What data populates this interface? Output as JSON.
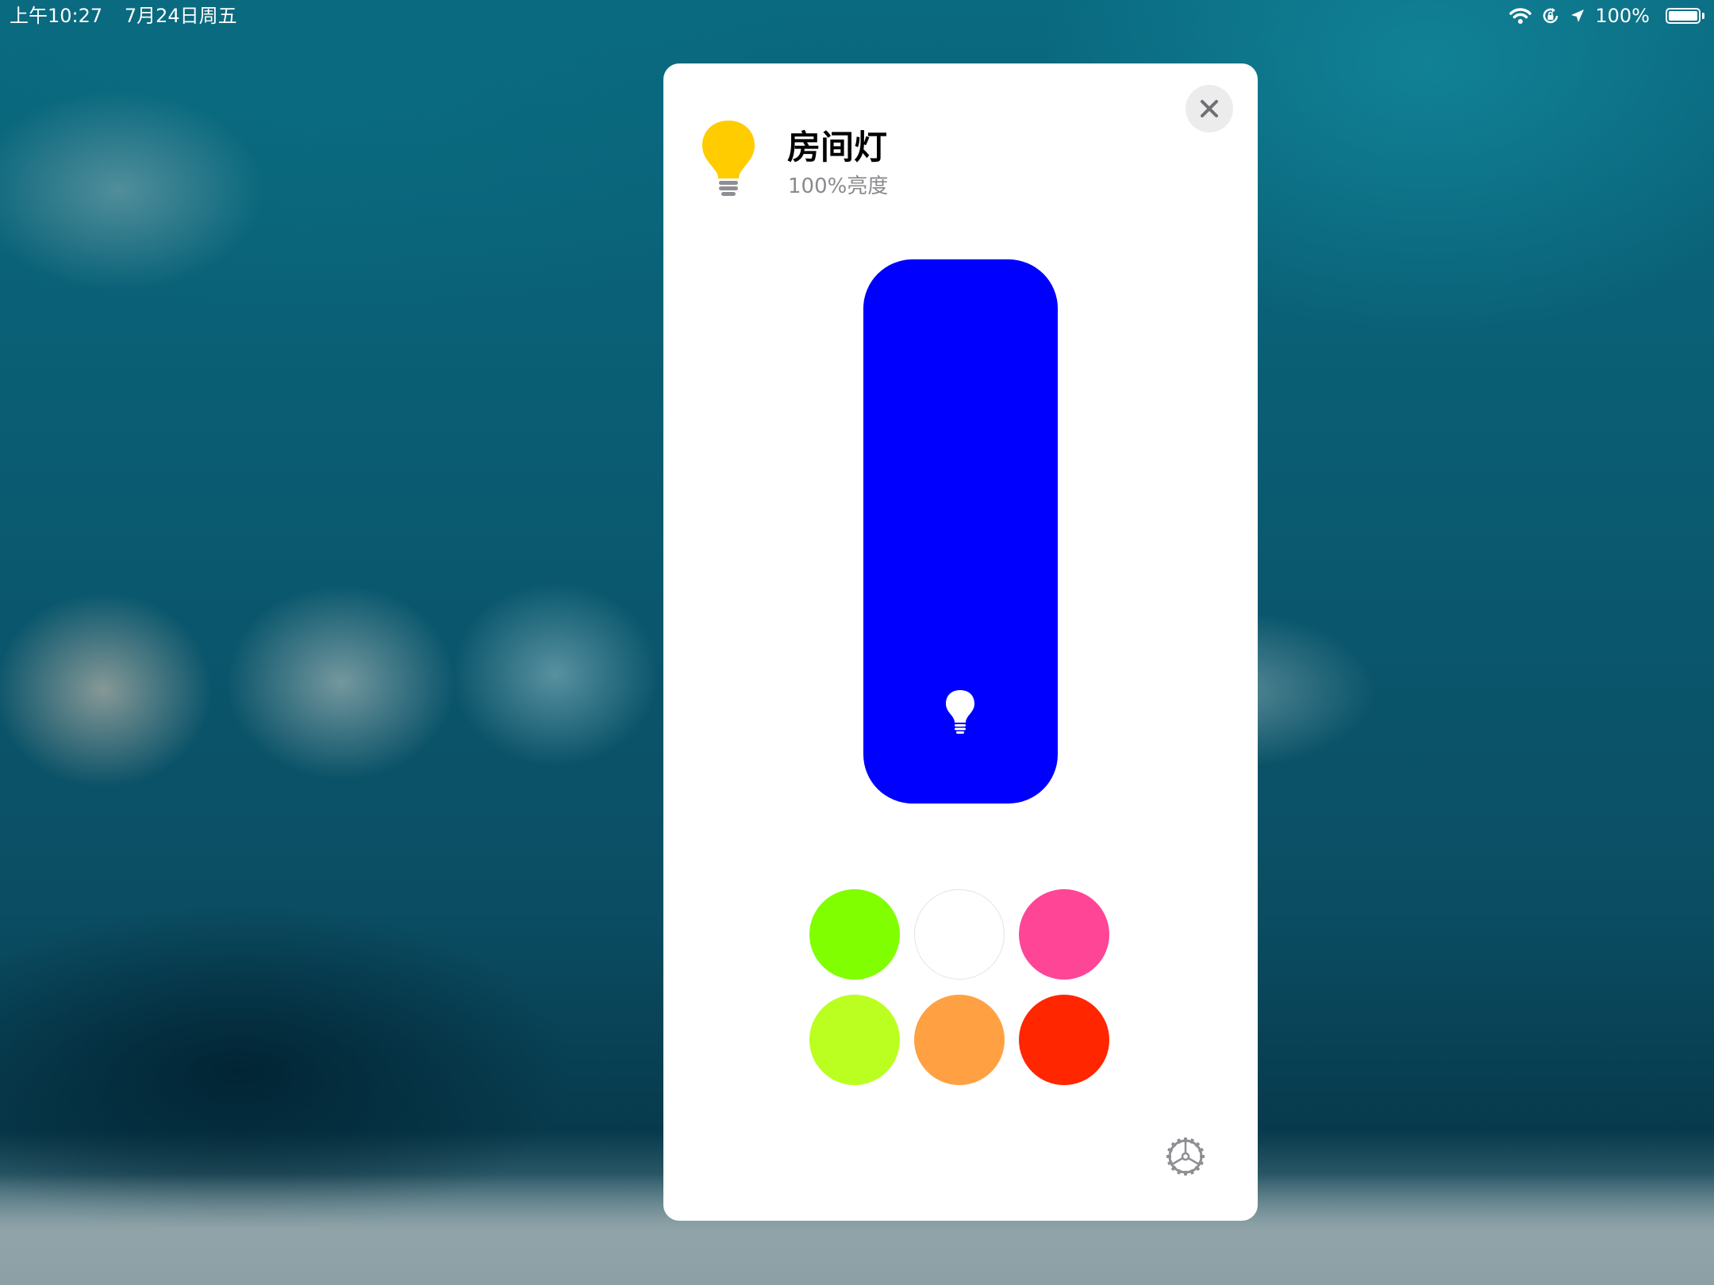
{
  "status_bar": {
    "time": "上午10:27",
    "date": "7月24日周五",
    "battery_text": "100%",
    "battery_level": 1.0,
    "icons": [
      "wifi-icon",
      "orientation-lock-icon",
      "location-arrow-icon",
      "battery-icon"
    ]
  },
  "accessory": {
    "name": "房间灯",
    "status": "100%亮度",
    "icon": "lightbulb-icon",
    "icon_color": "#ffcc00"
  },
  "brightness": {
    "level": 1.0,
    "color": "#0000ff",
    "icon": "lightbulb-icon"
  },
  "swatches": [
    {
      "color": "#80ff00"
    },
    {
      "color": "#ffffff"
    },
    {
      "color": "#ff4596"
    },
    {
      "color": "#bbff20"
    },
    {
      "color": "#ffa143"
    },
    {
      "color": "#ff2600"
    }
  ],
  "controls": {
    "close_icon": "close-icon",
    "settings_icon": "gear-icon"
  }
}
